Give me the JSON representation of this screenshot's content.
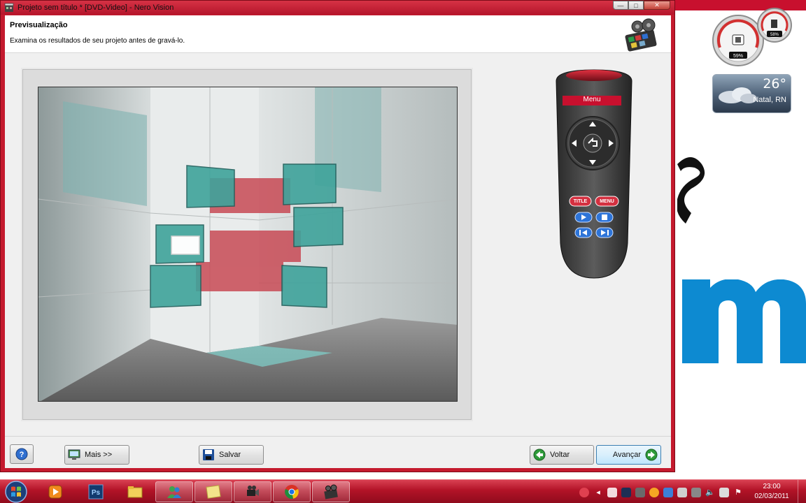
{
  "window": {
    "title": "Projeto sem título * [DVD-Video] - Nero Vision",
    "minimize_glyph": "—",
    "maximize_glyph": "□",
    "close_glyph": "✕"
  },
  "header": {
    "heading": "Previsualização",
    "subtitle": "Examina os resultados de seu projeto antes de gravá-lo."
  },
  "remote": {
    "menu_label": "Menu",
    "title_button": "TITLE",
    "menu_button": "MENU"
  },
  "footer": {
    "help_label": "?",
    "more_label": "Mais >>",
    "save_label": "Salvar",
    "back_label": "Voltar",
    "next_label": "Avançar"
  },
  "gadgets": {
    "cpu_percent": "59%",
    "memory_percent": "58%",
    "weather_temp": "26°",
    "weather_city": "Natal, RN"
  },
  "taskbar": {
    "items": [
      "windows-media-player",
      "photoshop",
      "windows-explorer",
      "live-messenger",
      "sticky-notes",
      "video-camera",
      "chrome",
      "nero-vision"
    ],
    "time": "23:00",
    "date": "02/03/2011"
  },
  "colors": {
    "accent_red": "#c41a2e",
    "taskbar_red": "#b21327",
    "logo_blue": "#0d8ad1",
    "cube_teal": "#3fa39b",
    "cube_red": "#c84a55"
  }
}
